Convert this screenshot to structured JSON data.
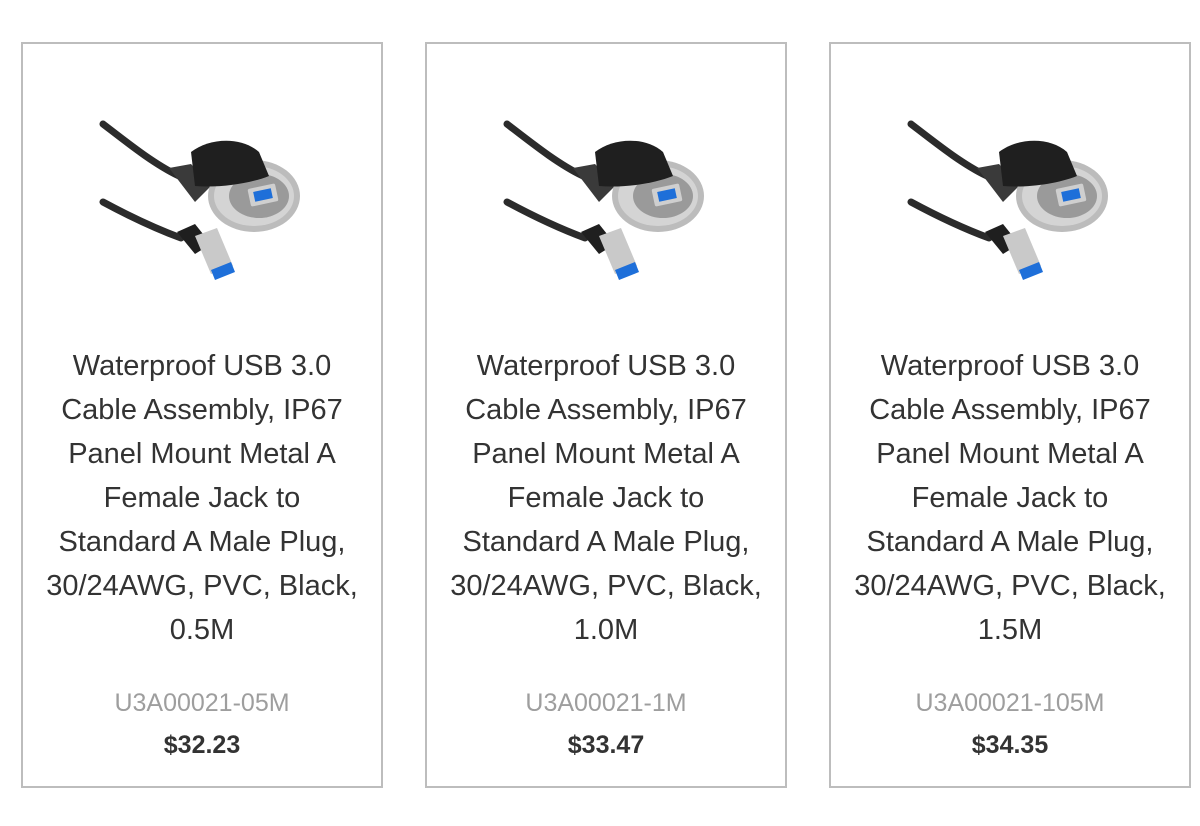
{
  "products": [
    {
      "title": "Waterproof USB 3.0 Cable Assembly, IP67 Panel Mount Metal A Female Jack to Standard A Male Plug, 30/24AWG, PVC, Black, 0.5M",
      "sku": "U3A00021-05M",
      "price": "$32.23",
      "image_icon": "usb-cable-panel-mount-icon"
    },
    {
      "title": "Waterproof USB 3.0 Cable Assembly, IP67 Panel Mount Metal A Female Jack to Standard A Male Plug, 30/24AWG, PVC, Black, 1.0M",
      "sku": "U3A00021-1M",
      "price": "$33.47",
      "image_icon": "usb-cable-panel-mount-icon"
    },
    {
      "title": "Waterproof USB 3.0 Cable Assembly, IP67 Panel Mount Metal A Female Jack to Standard A Male Plug, 30/24AWG, PVC, Black, 1.5M",
      "sku": "U3A00021-105M",
      "price": "$34.35",
      "image_icon": "usb-cable-panel-mount-icon"
    }
  ],
  "colors": {
    "border": "#bdbdbd",
    "text": "#333333",
    "sku": "#9e9e9e",
    "usb_blue": "#1e6fd9"
  }
}
